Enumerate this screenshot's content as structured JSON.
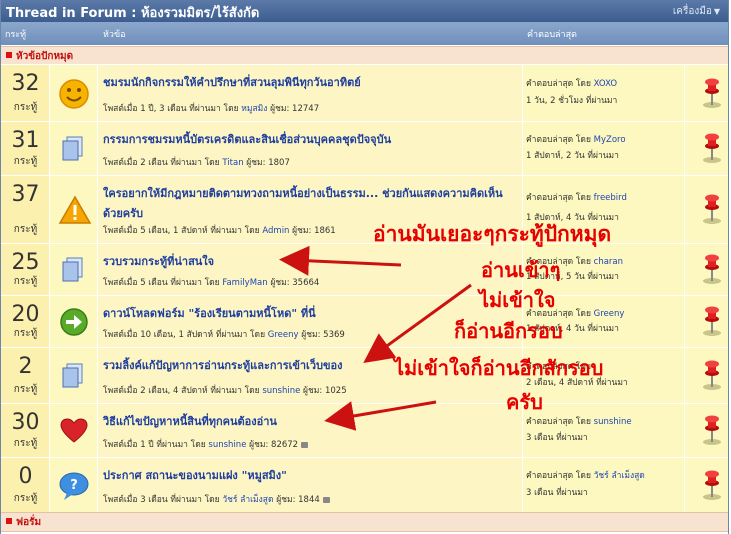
{
  "header": {
    "title": "Thread in Forum : ห้องรวมมิตร/ไร้สังกัด",
    "tools": "เครื่องมือ"
  },
  "columns": {
    "count": "กระทู้",
    "topic": "หัวข้อ",
    "last": "คำตอบล่าสุด"
  },
  "sections": {
    "pinned": "หัวข้อปักหมุด",
    "forum": "ฟอรั่ม"
  },
  "threads": [
    {
      "count": "32",
      "unit": "กระทู้",
      "icon": "smiley-icon",
      "title": "ชมรมนักกิจกรรมให้คำปรึกษาที่สวนลุมพินีทุกวันอาทิตย์",
      "meta": "โพสต์เมื่อ 1 ปี, 3 เดือน ที่ผ่านมา โดย ",
      "author": "หมูสมิง",
      "views": " ผู้ชม: 12747",
      "last_prefix": "คำตอบล่าสุด โดย ",
      "last_user": "XOXO",
      "last_time": "1 วัน, 2 ชั่วโมง ที่ผ่านมา"
    },
    {
      "count": "31",
      "unit": "กระทู้",
      "icon": "document-icon",
      "title": "กรรมการชมรมหนี้บัตรเครดิตและสินเชื่อส่วนบุคคลชุดปัจจุบัน",
      "meta": "โพสต์เมื่อ 2 เดือน ที่ผ่านมา โดย ",
      "author": "Titan",
      "views": " ผู้ชม: 1807",
      "last_prefix": "คำตอบล่าสุด โดย ",
      "last_user": "MyZoro",
      "last_time": "1 สัปดาห์, 2 วัน ที่ผ่านมา"
    },
    {
      "count": "37",
      "unit": "กระทู้",
      "icon": "warning-icon",
      "title": "ใครอยากให้มีกฎหมายติดตามทวงถามหนี้อย่างเป็นธรรม... ช่วยกันแสดงความคิดเห็นด้วยครับ",
      "meta": "โพสต์เมื่อ 5 เดือน, 1 สัปดาห์ ที่ผ่านมา โดย ",
      "author": "Admin",
      "views": " ผู้ชม: 1861",
      "last_prefix": "คำตอบล่าสุด โดย ",
      "last_user": "freebird",
      "last_time": "1 สัปดาห์, 4 วัน ที่ผ่านมา"
    },
    {
      "count": "25",
      "unit": "กระทู้",
      "icon": "document-icon",
      "title": "รวบรวมกระทู้ที่น่าสนใจ",
      "meta": "โพสต์เมื่อ 5 เดือน ที่ผ่านมา โดย ",
      "author": "FamilyMan",
      "views": " ผู้ชม: 35664",
      "last_prefix": "คำตอบล่าสุด โดย ",
      "last_user": "charan",
      "last_time": "1 สัปดาห์, 5 วัน ที่ผ่านมา"
    },
    {
      "count": "20",
      "unit": "กระทู้",
      "icon": "arrow-right-icon",
      "title": "ดาวน์โหลดฟอร์ม \"ร้องเรียนตามหนี้โหด\" ที่นี่",
      "meta": "โพสต์เมื่อ 10 เดือน, 1 สัปดาห์ ที่ผ่านมา โดย ",
      "author": "Greeny",
      "views": " ผู้ชม: 5369",
      "last_prefix": "คำตอบล่าสุด โดย ",
      "last_user": "Greeny",
      "last_time": "1 สัปดาห์, 4 วัน ที่ผ่านมา"
    },
    {
      "count": "2",
      "unit": "กระทู้",
      "icon": "document-icon",
      "title": "รวมลิ้งค์แก้ปัญหาการอ่านกระทู้และการเข้าเว็บของ",
      "meta": "โพสต์เมื่อ 2 เดือน, 4 สัปดาห์ ที่ผ่านมา โดย ",
      "author": "sunshine",
      "views": " ผู้ชม: 1025",
      "last_prefix": "คำตอบล่าสุด โดย ",
      "last_user": "",
      "last_time": "2 เดือน, 4 สัปดาห์ ที่ผ่านมา"
    },
    {
      "count": "30",
      "unit": "กระทู้",
      "icon": "heart-icon",
      "title": "วิธีแก้ไขปัญหาหนี้สินที่ทุกคนต้องอ่าน",
      "meta": "โพสต์เมื่อ 1 ปี ที่ผ่านมา โดย ",
      "author": "sunshine",
      "views": " ผู้ชม: 82672",
      "last_prefix": "คำตอบล่าสุด โดย ",
      "last_user": "sunshine",
      "last_time": "3 เดือน ที่ผ่านมา"
    },
    {
      "count": "0",
      "unit": "กระทู้",
      "icon": "chat-bubble-icon",
      "title": "ประกาศ สถานะของนามแฝง \"หมูสมิง\"",
      "meta": "โพสต์เมื่อ 3 เดือน ที่ผ่านมา โดย ",
      "author": "วัชร์ ลำเม็งสูด",
      "views": " ผู้ชม: 1844",
      "last_prefix": "คำตอบล่าสุด โดย ",
      "last_user": "วัชร์ ลำเม็งสูด",
      "last_time": "3 เดือน ที่ผ่านมา"
    }
  ],
  "notes": {
    "n1": "อ่านมันเยอะๆกระทู้ปักหมุด",
    "n2": "อ่านเข้าๆ",
    "n3": "ไม่เข้าใจ",
    "n4": "ก็อ่านอีกรอบ",
    "n5": "ไม่เข้าใจก็อ่านอีกสักรอบ",
    "n6": "ครับ"
  }
}
